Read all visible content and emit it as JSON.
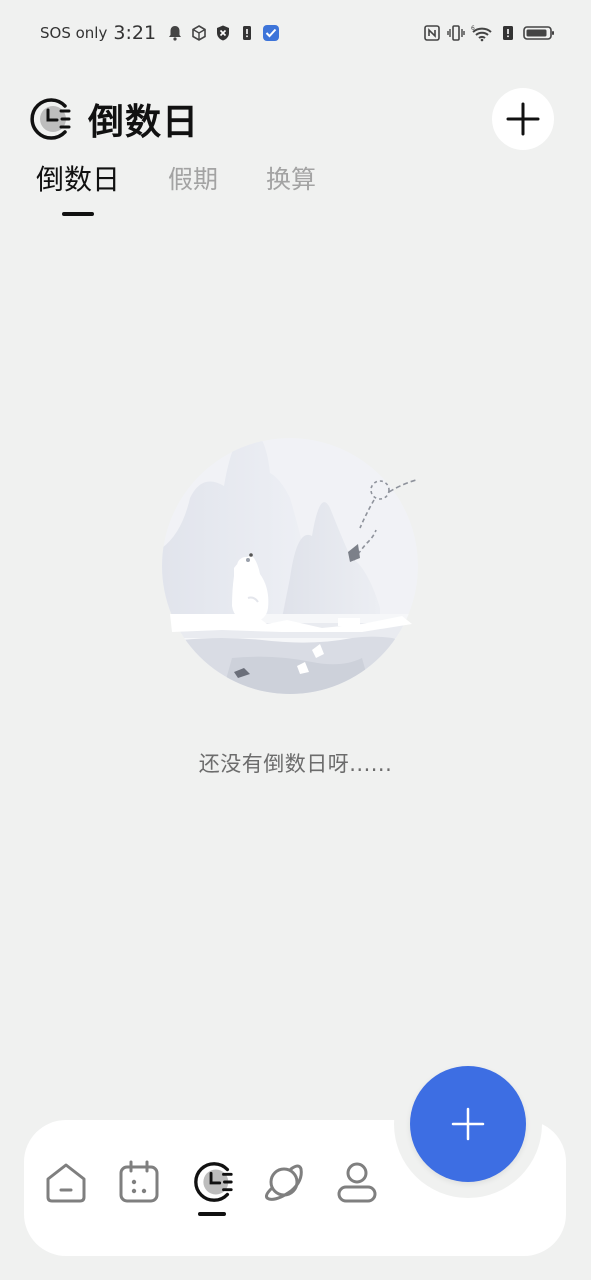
{
  "status_bar": {
    "carrier": "SOS only",
    "time": "3:21",
    "network_superscript": "6"
  },
  "header": {
    "title": "倒数日",
    "logo_icon": "countdown-clock-icon",
    "add_icon": "plus-icon"
  },
  "tabs": [
    {
      "label": "倒数日",
      "active": true
    },
    {
      "label": "假期",
      "active": false
    },
    {
      "label": "换算",
      "active": false
    }
  ],
  "empty_state": {
    "message": "还没有倒数日呀......",
    "illustration": "polar-bear-landscape"
  },
  "bottom_nav": {
    "items": [
      {
        "icon": "home-icon",
        "active": false
      },
      {
        "icon": "calendar-icon",
        "active": false
      },
      {
        "icon": "countdown-clock-icon",
        "active": true
      },
      {
        "icon": "planet-icon",
        "active": false
      },
      {
        "icon": "profile-icon",
        "active": false
      }
    ]
  },
  "fab": {
    "icon": "plus-icon"
  },
  "colors": {
    "background": "#f0f1f0",
    "accent": "#3d6ee3",
    "text_primary": "#111111",
    "text_inactive": "#a3a3a3",
    "text_secondary": "#6c6c6c"
  }
}
